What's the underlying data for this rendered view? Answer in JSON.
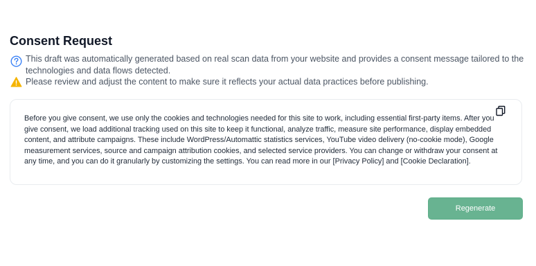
{
  "page": {
    "title": "Consent Request"
  },
  "notices": [
    {
      "icon": "question-circle-icon",
      "color": "#3b82f6",
      "text": "This draft was automatically generated based on real scan data from your website and provides a consent message tailored to the technologies and data flows detected."
    },
    {
      "icon": "warning-triangle-icon",
      "color": "#f5b400",
      "text": "Please review and adjust the content to make sure it reflects your actual data practices before publishing."
    }
  ],
  "message": {
    "text": "Before you give consent, we use only the cookies and technologies needed for this site to work, including essential first-party items. After you give consent, we load additional tracking used on this site to keep it functional, analyze traffic, measure site performance, display embedded content, and attribute campaigns. These include WordPress/Automattic statistics services, YouTube video delivery (no-cookie mode), Google measurement services, source and campaign attribution cookies, and selected service providers. You can change or withdraw your consent at any time, and you can do it granularly by customizing the settings. You can read more in our [Privacy Policy] and [Cookie Declaration].",
    "copy_icon": "copy-icon"
  },
  "actions": {
    "regenerate_label": "Regenerate",
    "accent_color": "#68b391"
  }
}
